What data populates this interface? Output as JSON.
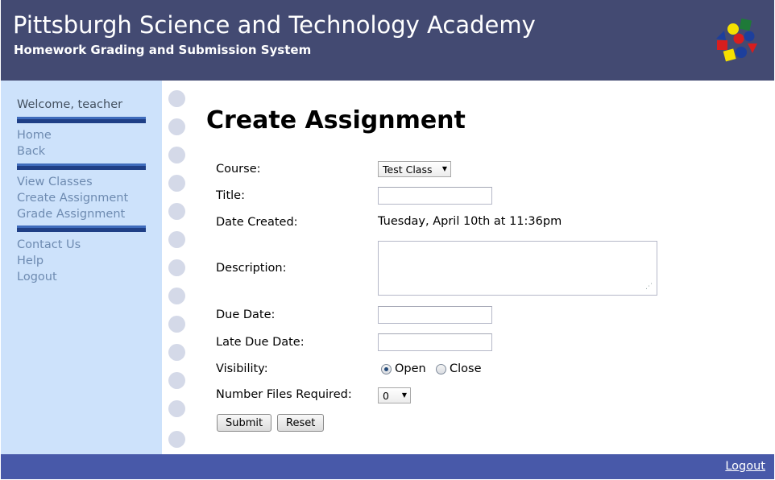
{
  "header": {
    "title": "Pittsburgh Science and Technology Academy",
    "subtitle": "Homework Grading and Submission System",
    "logo_icon": "colorful-shapes-logo"
  },
  "sidebar": {
    "welcome": "Welcome, teacher",
    "group1": [
      {
        "label": "Home"
      },
      {
        "label": "Back"
      }
    ],
    "group2": [
      {
        "label": "View Classes"
      },
      {
        "label": "Create Assignment"
      },
      {
        "label": "Grade Assignment"
      }
    ],
    "group3": [
      {
        "label": "Contact Us"
      },
      {
        "label": "Help"
      },
      {
        "label": "Logout"
      }
    ]
  },
  "main": {
    "page_title": "Create Assignment",
    "form": {
      "course_label": "Course:",
      "course_value": "Test Class",
      "title_label": "Title:",
      "title_value": "",
      "date_created_label": "Date Created:",
      "date_created_value": "Tuesday, April 10th at 11:36pm",
      "description_label": "Description:",
      "description_value": "",
      "due_date_label": "Due Date:",
      "due_date_value": "",
      "late_due_date_label": "Late Due Date:",
      "late_due_date_value": "",
      "visibility_label": "Visibility:",
      "visibility_options": [
        {
          "label": "Open",
          "checked": true
        },
        {
          "label": "Close",
          "checked": false
        }
      ],
      "files_required_label": "Number Files Required:",
      "files_required_value": "0",
      "submit_label": "Submit",
      "reset_label": "Reset"
    }
  },
  "footer": {
    "logout_label": "Logout"
  },
  "colors": {
    "header_bg": "#434a72",
    "sidebar_bg": "#cde2fb",
    "footer_bg": "#4859a9",
    "nav_link": "#6e8bb1",
    "divider": "#1f3f86"
  }
}
